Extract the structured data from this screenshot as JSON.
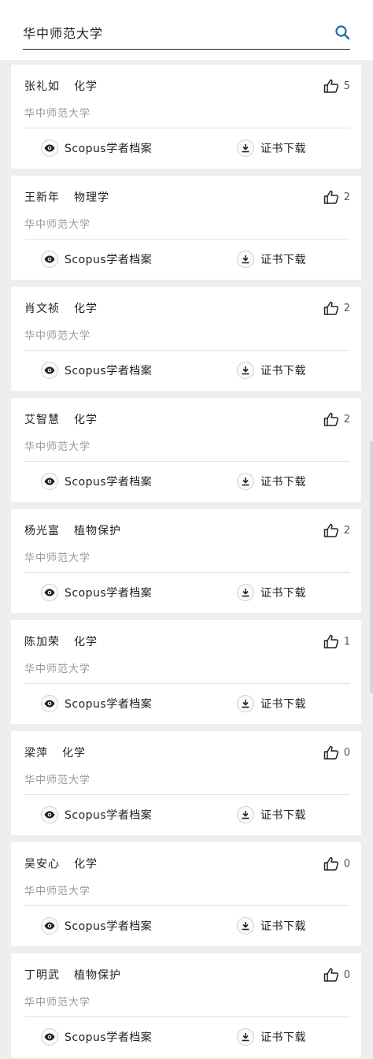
{
  "search": {
    "value": "华中师范大学"
  },
  "results": [
    {
      "name": "张礼如",
      "major": "化学",
      "affiliation": "华中师范大学",
      "likes": "5"
    },
    {
      "name": "王新年",
      "major": "物理学",
      "affiliation": "华中师范大学",
      "likes": "2"
    },
    {
      "name": "肖文祯",
      "major": "化学",
      "affiliation": "华中师范大学",
      "likes": "2"
    },
    {
      "name": "艾智慧",
      "major": "化学",
      "affiliation": "华中师范大学",
      "likes": "2"
    },
    {
      "name": "杨光富",
      "major": "植物保护",
      "affiliation": "华中师范大学",
      "likes": "2"
    },
    {
      "name": "陈加荣",
      "major": "化学",
      "affiliation": "华中师范大学",
      "likes": "1"
    },
    {
      "name": "梁萍",
      "major": "化学",
      "affiliation": "华中师范大学",
      "likes": "0"
    },
    {
      "name": "吴安心",
      "major": "化学",
      "affiliation": "华中师范大学",
      "likes": "0"
    },
    {
      "name": "丁明武",
      "major": "植物保护",
      "affiliation": "华中师范大学",
      "likes": "0"
    }
  ],
  "actions": {
    "scopus_label": "Scopus学者档案",
    "cert_label": "证书下载"
  },
  "colors": {
    "accent": "#1a6fa8",
    "background": "#eeeeee",
    "card": "#ffffff",
    "muted_text": "#9a9a9a"
  },
  "icons": {
    "search": "search-icon",
    "like": "thumbs-up-icon",
    "view": "eye-icon",
    "download": "download-icon"
  }
}
